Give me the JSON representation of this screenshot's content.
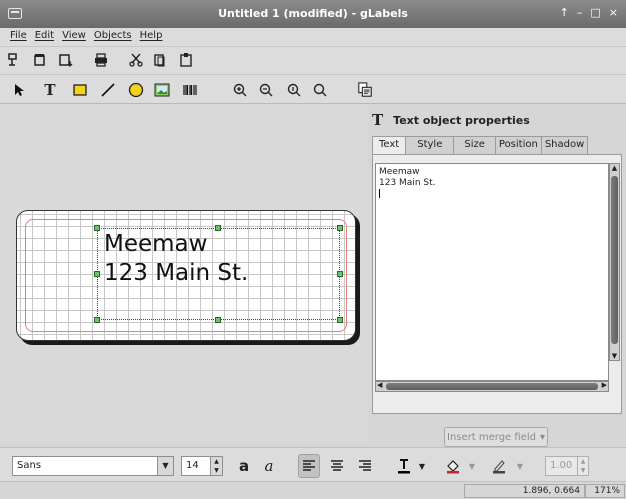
{
  "window": {
    "title": "Untitled 1 (modified) - gLabels",
    "controls": [
      "↑",
      "–",
      "□",
      "×"
    ]
  },
  "menubar": {
    "items": [
      "File",
      "Edit",
      "View",
      "Objects",
      "Help"
    ]
  },
  "toolbar_file": {
    "icons": [
      "new-icon",
      "open-icon",
      "save-icon",
      "print-icon",
      "cut-icon",
      "copy-icon",
      "paste-icon"
    ]
  },
  "toolbar_draw": {
    "icons": [
      "arrow-icon",
      "text-tool-icon",
      "box-tool-icon",
      "line-tool-icon",
      "ellipse-tool-icon",
      "image-tool-icon",
      "barcode-tool-icon",
      "zoom-in-icon",
      "zoom-out-icon",
      "zoom-1to1-icon",
      "zoom-fit-icon",
      "merge-properties-icon"
    ]
  },
  "label": {
    "line1": "Meemaw",
    "line2": "123 Main St."
  },
  "panel": {
    "title": "Text object properties",
    "tabs": [
      "Text",
      "Style",
      "Size",
      "Position",
      "Shadow"
    ],
    "active_tab": "Text",
    "text_content_line1": "Meemaw",
    "text_content_line2": "123 Main St.",
    "merge_button": "Insert merge field"
  },
  "formatbar": {
    "font_family": "Sans",
    "font_size": "14",
    "bold_label": "a",
    "italic_label": "a",
    "line_width": "1.00",
    "colors": {
      "text": "#000000",
      "fill": "#cc2222",
      "line": "#444444"
    }
  },
  "status": {
    "cursor": "1.896, 0.664",
    "zoom": "171%"
  }
}
